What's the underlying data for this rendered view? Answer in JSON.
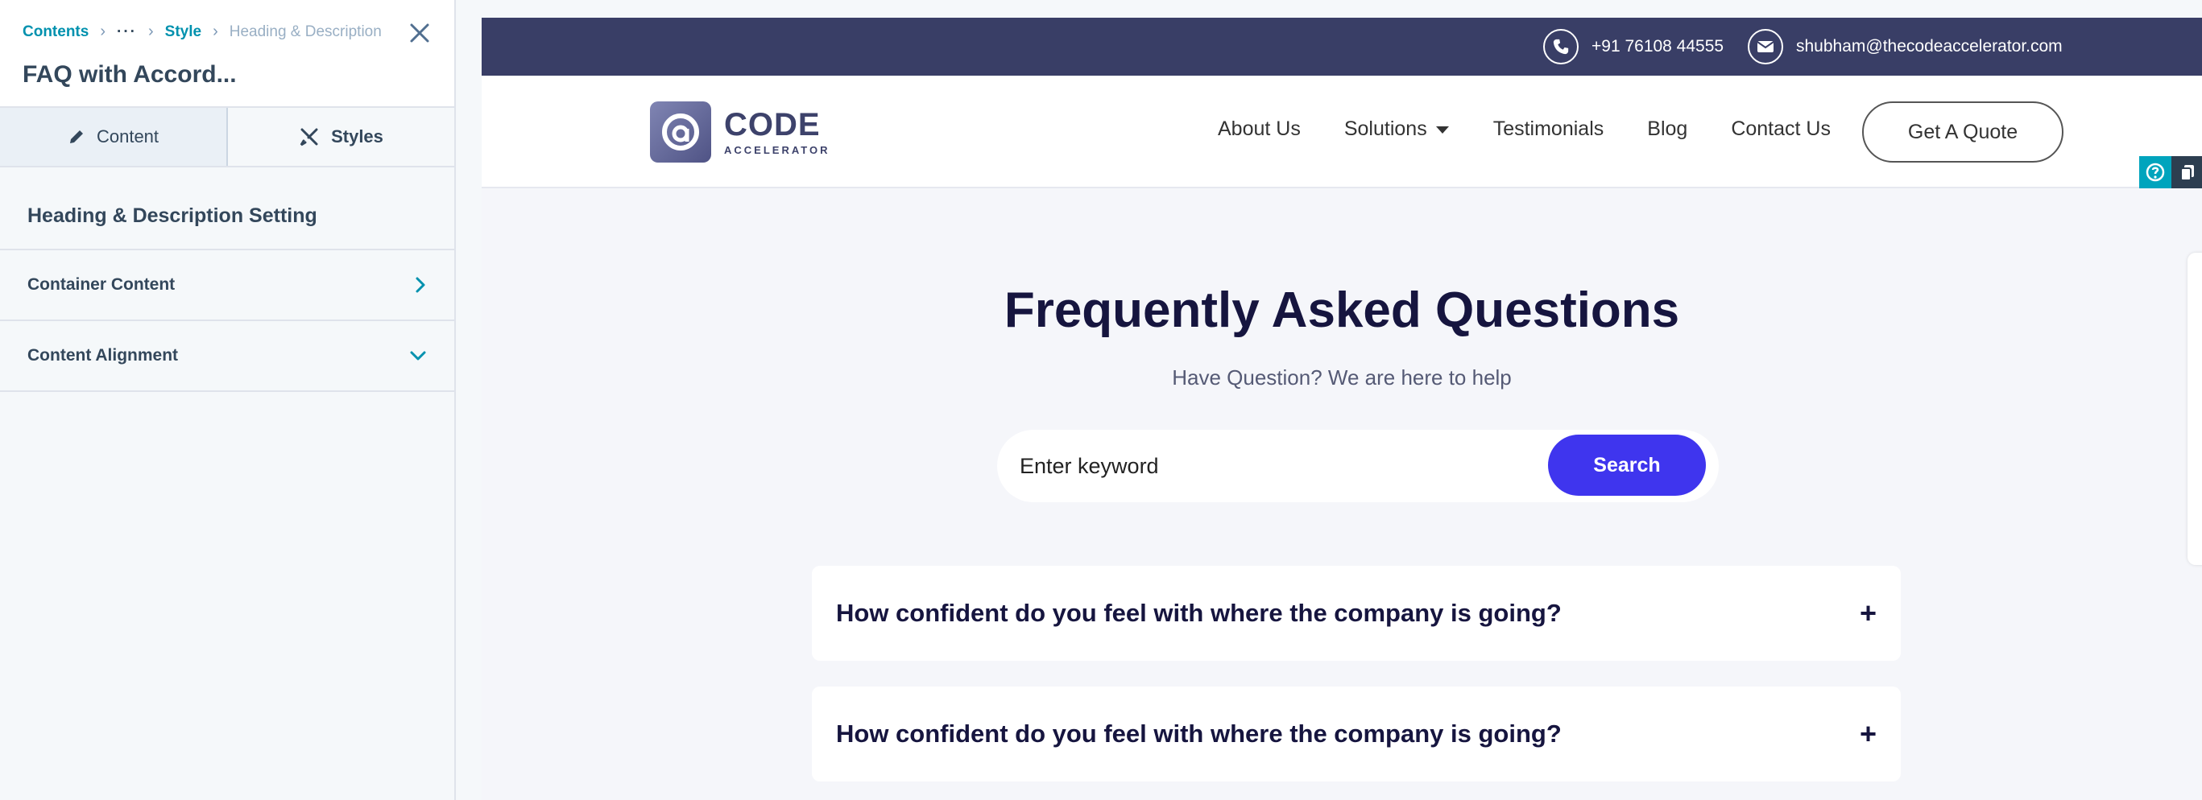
{
  "editor": {
    "breadcrumb": {
      "root": "Contents",
      "ellipsis": "···",
      "style": "Style",
      "current": "Heading & Description"
    },
    "title": "FAQ with Accord...",
    "tabs": [
      {
        "label": "Content",
        "icon": "pencil-icon",
        "active": false
      },
      {
        "label": "Styles",
        "icon": "brush-icon",
        "active": true
      }
    ],
    "section_title": "Heading & Description Setting",
    "groups": [
      {
        "label": "Container Content",
        "icon": "chevron-right-icon"
      },
      {
        "label": "Content Alignment",
        "icon": "chevron-down-icon"
      }
    ]
  },
  "site": {
    "phone": "+91 76108 44555",
    "email": "shubham@thecodeaccelerator.com",
    "logo": {
      "main": "CODE",
      "sub": "ACCELERATOR"
    },
    "nav": [
      "About Us",
      "Solutions",
      "Testimonials",
      "Blog",
      "Contact Us"
    ],
    "cta": "Get A Quote",
    "heading": "Frequently Asked Questions",
    "subheading": "Have Question? We are here to help",
    "search": {
      "placeholder": "Enter keyword",
      "button": "Search"
    },
    "faqs": [
      "How confident do you feel with where the company is going?",
      "How confident do you feel with where the company is going?"
    ]
  },
  "colors": {
    "topbar": "#393e66",
    "accent": "#3f35ee",
    "heading": "#16153f",
    "editor_link": "#0091ae"
  }
}
